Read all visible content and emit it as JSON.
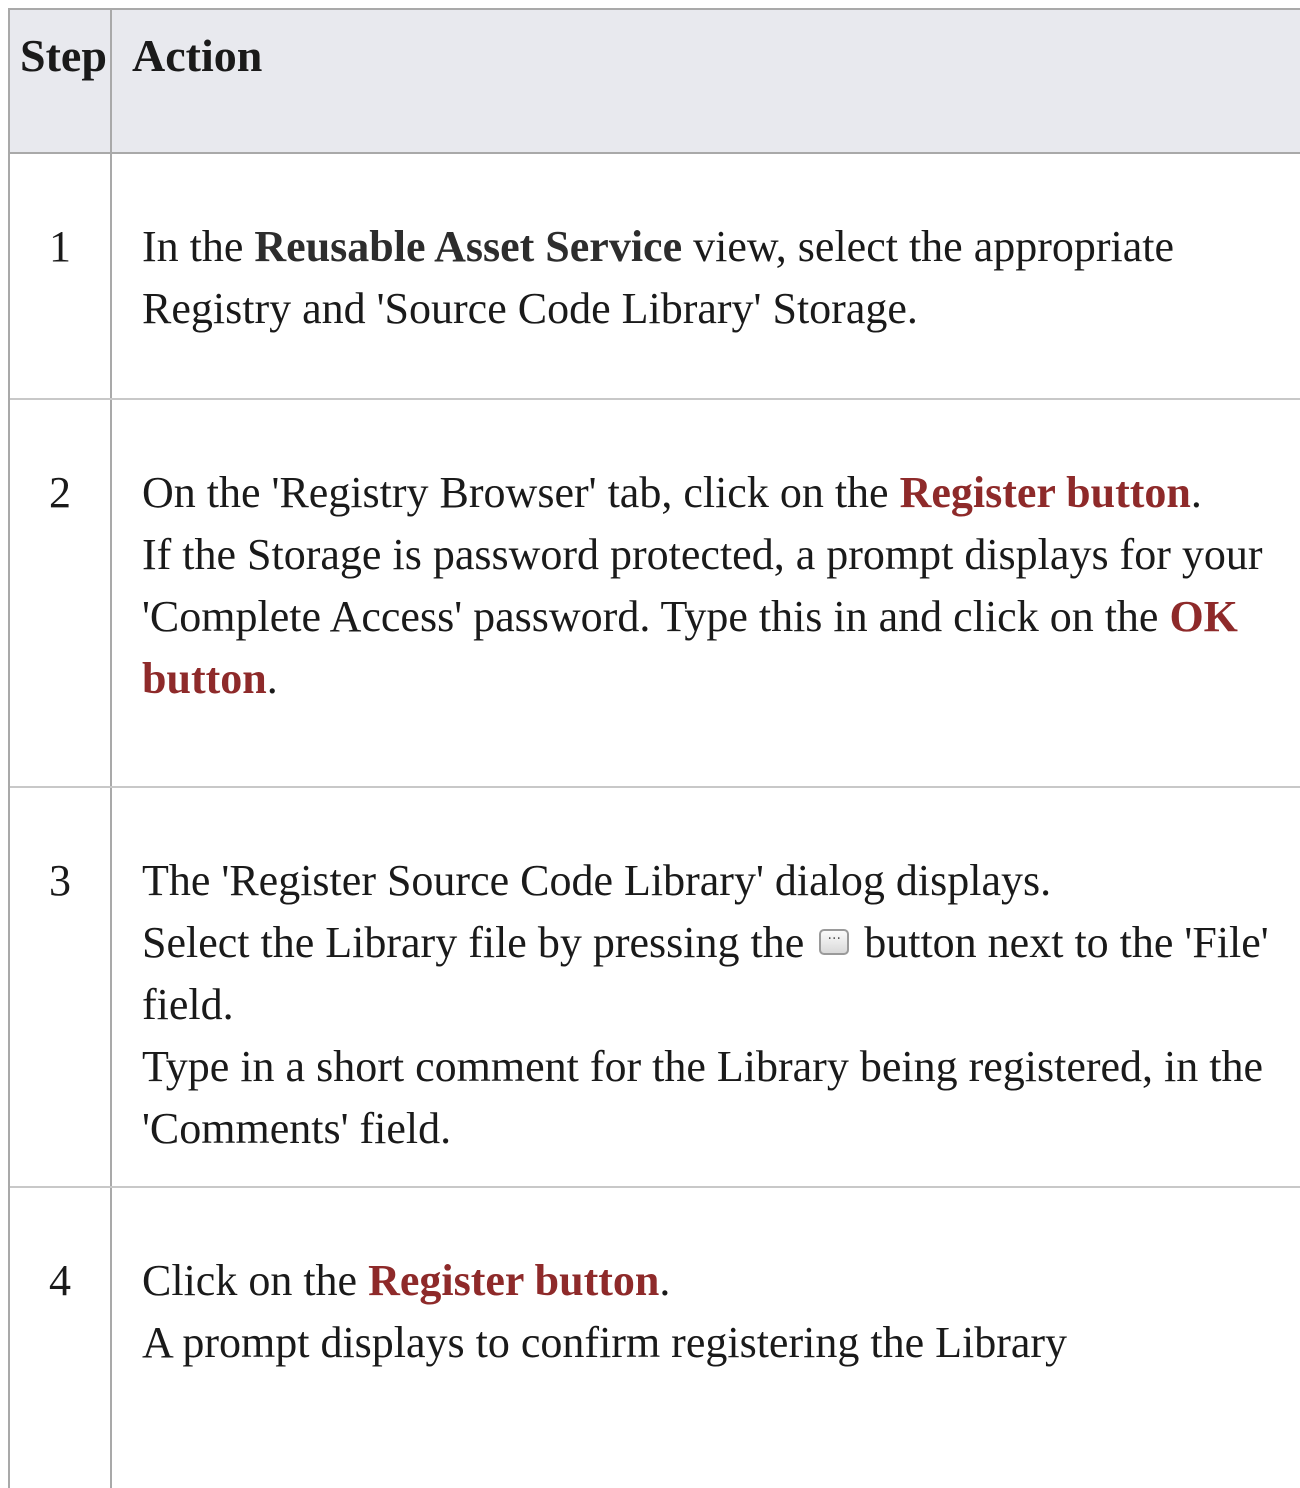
{
  "table": {
    "header": {
      "step": "Step",
      "action": "Action"
    },
    "rows": [
      {
        "step": "1",
        "p1_a": "In the ",
        "p1_b": "Reusable Asset Service",
        "p1_c": " view, select the appropriate Registry and 'Source Code Library' Storage."
      },
      {
        "step": "2",
        "p1_a": "On the 'Registry Browser' tab, click on the ",
        "p1_b": "Register button",
        "p1_c": ".",
        "p2_a": "If the Storage is password protected, a prompt displays for your 'Complete Access' password. Type this in and click on the ",
        "p2_b": "OK button",
        "p2_c": "."
      },
      {
        "step": "3",
        "p1": "The 'Register Source Code Library' dialog displays.",
        "p2_a": "Select the Library file by pressing the ",
        "p2_icon": "ellipsis-browse-button-icon",
        "p2_b": " button next to the 'File' field.",
        "p3": "Type in a short comment for the Library being registered, in the 'Comments' field."
      },
      {
        "step": "4",
        "p1_a": "Click on the ",
        "p1_b": "Register button",
        "p1_c": ".",
        "p2": "A prompt displays to confirm registering the Library"
      }
    ]
  },
  "colors": {
    "header_bg": "#e8e9ee",
    "link": "#8e2a2a",
    "border": "#a9a9a9"
  }
}
